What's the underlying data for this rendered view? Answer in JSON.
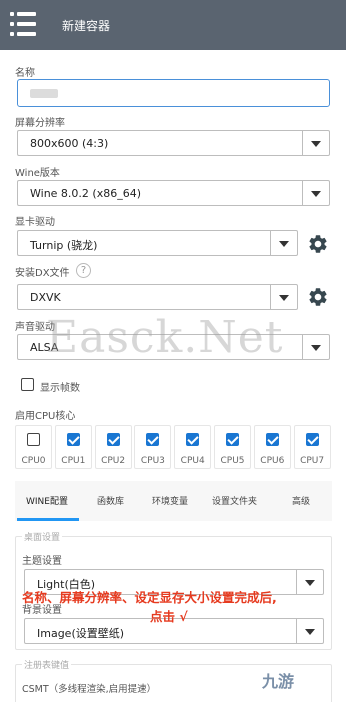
{
  "appbar": {
    "title": "新建容器",
    "menu_icon": "hamburger-menu-icon"
  },
  "form": {
    "name_label": "名称",
    "name_value": "",
    "resolution_label": "屏幕分辨率",
    "resolution_value": "800x600 (4:3)",
    "wine_label": "Wine版本",
    "wine_value": "Wine 8.0.2 (x86_64)",
    "gpu_label": "显卡驱动",
    "gpu_value": "Turnip (骁龙)",
    "dx_label": "安装DX文件",
    "dx_help": "?",
    "dx_value": "DXVK",
    "audio_label": "声音驱动",
    "audio_value": "ALSA",
    "show_fps_label": "显示帧数",
    "show_fps_checked": false,
    "cpu_label": "启用CPU核心",
    "cpu_cores": [
      {
        "label": "CPU0",
        "checked": false
      },
      {
        "label": "CPU1",
        "checked": true
      },
      {
        "label": "CPU2",
        "checked": true
      },
      {
        "label": "CPU3",
        "checked": true
      },
      {
        "label": "CPU4",
        "checked": true
      },
      {
        "label": "CPU5",
        "checked": true
      },
      {
        "label": "CPU6",
        "checked": true
      },
      {
        "label": "CPU7",
        "checked": true
      }
    ]
  },
  "tabs": [
    "WINE配置",
    "函数库",
    "环境变量",
    "设置文件夹",
    "高级"
  ],
  "active_tab": "WINE配置",
  "desktop_settings": {
    "group_title": "桌面设置",
    "theme_label": "主题设置",
    "theme_value": "Light(白色)",
    "background_label": "背景设置",
    "background_value": "Image(设置壁纸)"
  },
  "registry": {
    "group_title": "注册表键值",
    "csmt_label": "CSMT（多线程渲染,启用提速）"
  },
  "overlay": {
    "line1": "名称、屏幕分辨率、设定显存大小设置完成后,",
    "line2": "点击 √"
  },
  "watermark": "Easck.Net",
  "logo": "九游",
  "colors": {
    "appbar": "#5a6470",
    "accent": "#1976d2",
    "focus_border": "#4a90d9",
    "overlay_text": "#e63a1f"
  },
  "icons": {
    "gear": "gear-icon",
    "help": "question-circle-icon",
    "dropdown": "dropdown-arrow-icon"
  }
}
